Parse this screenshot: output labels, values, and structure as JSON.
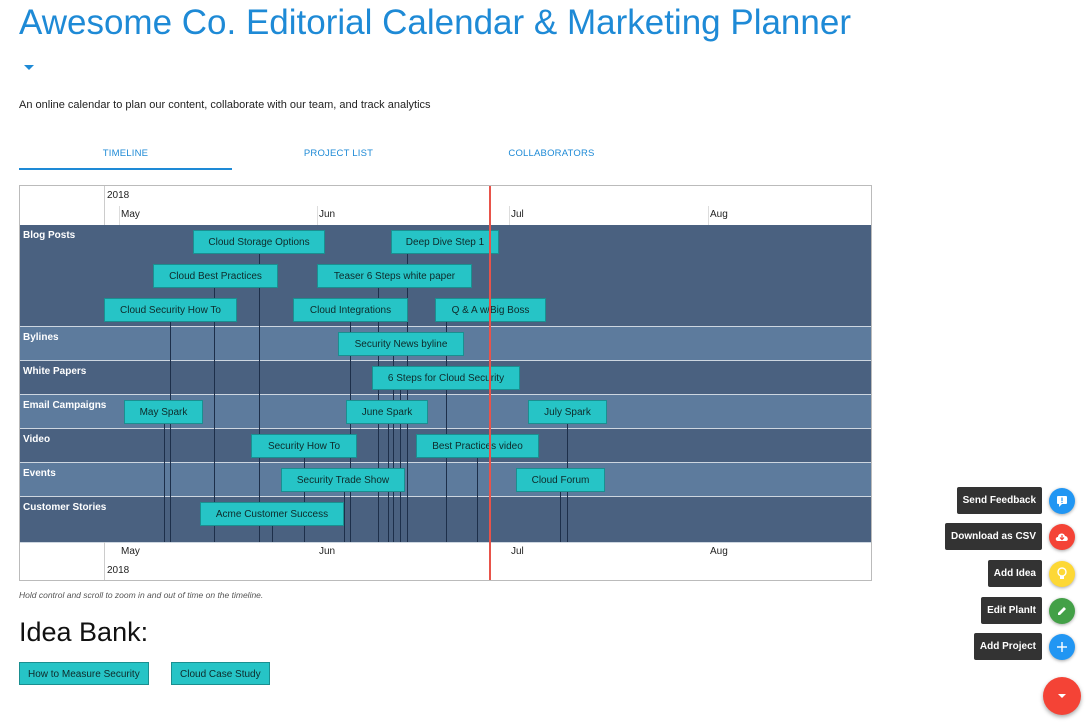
{
  "header": {
    "title": "Awesome Co. Editorial Calendar & Marketing Planner",
    "subtitle": "An online calendar to plan our content, collaborate with our team, and track analytics"
  },
  "tabs": [
    {
      "label": "TIMELINE"
    },
    {
      "label": "PROJECT LIST"
    },
    {
      "label": "COLLABORATORS"
    }
  ],
  "timeline": {
    "year": "2018",
    "months": [
      "May",
      "Jun",
      "Jul",
      "Aug"
    ],
    "groups": [
      {
        "label": "Blog Posts"
      },
      {
        "label": "Bylines"
      },
      {
        "label": "White Papers"
      },
      {
        "label": "Email Campaigns"
      },
      {
        "label": "Video"
      },
      {
        "label": "Events"
      },
      {
        "label": "Customer Stories"
      }
    ],
    "items": {
      "cloud_storage_options": "Cloud Storage Options",
      "deep_dive_step_1": "Deep Dive Step 1",
      "cloud_best_practices": "Cloud Best Practices",
      "teaser_6_steps": "Teaser 6 Steps white paper",
      "cloud_security_how_to": "Cloud Security How To",
      "cloud_integrations": "Cloud Integrations",
      "qa_big_boss": "Q & A w/Big Boss",
      "security_news_byline": "Security News byline",
      "six_steps_cloud_security": "6 Steps for Cloud Security",
      "may_spark": "May Spark",
      "june_spark": "June Spark",
      "july_spark": "July Spark",
      "security_how_to": "Security How To",
      "best_practices_video": "Best Practices video",
      "security_trade_show": "Security Trade Show",
      "cloud_forum": "Cloud Forum",
      "acme_customer_success": "Acme Customer Success"
    },
    "hint": "Hold control and scroll to zoom in and out of time on the timeline.",
    "now_marker_color": "#e8534a"
  },
  "idea_bank": {
    "title": "Idea Bank:",
    "ideas": [
      "How to Measure Security",
      "Cloud Case Study"
    ]
  },
  "fab_menu": {
    "actions": [
      {
        "label": "Send Feedback",
        "icon": "feedback-icon",
        "color": "#2196f3"
      },
      {
        "label": "Download as CSV",
        "icon": "cloud-download-icon",
        "color": "#f44336"
      },
      {
        "label": "Add Idea",
        "icon": "lightbulb-icon",
        "color": "#fdd835"
      },
      {
        "label": "Edit PlanIt",
        "icon": "pencil-icon",
        "color": "#43a047"
      },
      {
        "label": "Add Project",
        "icon": "plus-icon",
        "color": "#2196f3"
      }
    ],
    "main_color": "#f44336"
  },
  "colors": {
    "accent": "#1e8ad6",
    "item": "#26c4c6",
    "group_dark": "#4a6180",
    "group_light": "#5d7b9d"
  }
}
